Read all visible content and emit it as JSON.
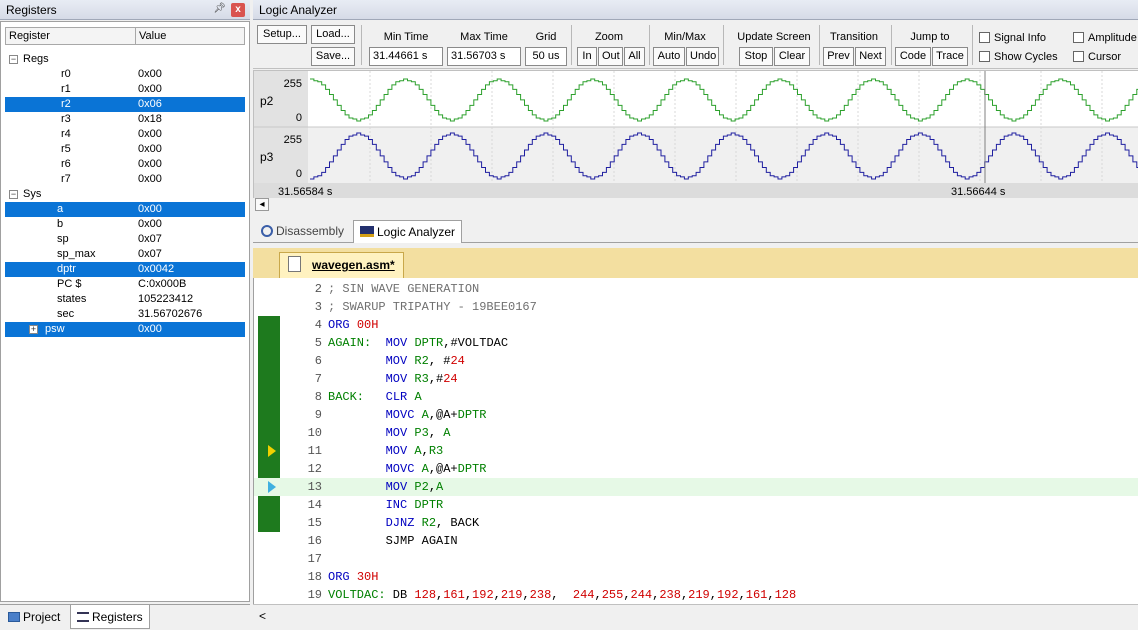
{
  "registers_panel": {
    "title": "Registers",
    "pin": "\u0013",
    "col_register": "Register",
    "col_value": "Value",
    "groups": [
      {
        "name": "Regs",
        "expander": "−"
      },
      {
        "name": "Sys",
        "expander": "−"
      }
    ],
    "regs": [
      {
        "name": "r0",
        "value": "0x00"
      },
      {
        "name": "r1",
        "value": "0x00"
      },
      {
        "name": "r2",
        "value": "0x06"
      },
      {
        "name": "r3",
        "value": "0x18"
      },
      {
        "name": "r4",
        "value": "0x00"
      },
      {
        "name": "r5",
        "value": "0x00"
      },
      {
        "name": "r6",
        "value": "0x00"
      },
      {
        "name": "r7",
        "value": "0x00"
      }
    ],
    "sys": [
      {
        "name": "a",
        "value": "0x00"
      },
      {
        "name": "b",
        "value": "0x00"
      },
      {
        "name": "sp",
        "value": "0x07"
      },
      {
        "name": "sp_max",
        "value": "0x07"
      },
      {
        "name": "dptr",
        "value": "0x0042"
      },
      {
        "name": "PC  $",
        "value": "C:0x000B"
      },
      {
        "name": "states",
        "value": "105223412"
      },
      {
        "name": "sec",
        "value": "31.56702676"
      },
      {
        "name": "psw",
        "value": "0x00"
      }
    ],
    "psw_expander": "+",
    "tabs": {
      "project": "Project",
      "registers": "Registers"
    }
  },
  "logic_analyzer": {
    "title": "Logic Analyzer",
    "setup": "Setup...",
    "load": "Load...",
    "save": "Save...",
    "min_time_label": "Min Time",
    "min_time": "31.44661 s",
    "max_time_label": "Max Time",
    "max_time": "31.56703 s",
    "grid_label": "Grid",
    "grid": "50 us",
    "zoom_label": "Zoom",
    "zoom_in": "In",
    "zoom_out": "Out",
    "zoom_all": "All",
    "minmax_label": "Min/Max",
    "auto": "Auto",
    "undo": "Undo",
    "update_label": "Update Screen",
    "stop": "Stop",
    "clear": "Clear",
    "transition_label": "Transition",
    "prev": "Prev",
    "next": "Next",
    "jump_label": "Jump to",
    "code": "Code",
    "trace": "Trace",
    "signal_info": "Signal Info",
    "amplitude": "Amplitude",
    "show_cycles": "Show Cycles",
    "cursor": "Cursor",
    "signals": [
      {
        "name": "p2",
        "max": "255",
        "min": "0",
        "color": "#2ca02c"
      },
      {
        "name": "p3",
        "max": "255",
        "min": "0",
        "color": "#1f1fa0"
      }
    ],
    "time_left": "31.56584 s",
    "time_right": "31.56644 s",
    "scroll_left": "◂"
  },
  "editor_tabs": {
    "disassembly": "Disassembly",
    "logic_analyzer": "Logic Analyzer"
  },
  "file_tab": "wavegen.asm*",
  "code": [
    {
      "n": "2",
      "parts": [
        [
          "cm",
          "; SIN WAVE GENERATION"
        ]
      ]
    },
    {
      "n": "3",
      "parts": [
        [
          "cm",
          "; SWARUP TRIPATHY - 19BEE0167"
        ]
      ]
    },
    {
      "n": "4",
      "parts": [
        [
          "kw",
          "ORG "
        ],
        [
          "nm",
          "00H"
        ]
      ]
    },
    {
      "n": "5",
      "parts": [
        [
          "lb",
          "AGAIN:"
        ],
        [
          "",
          "  "
        ],
        [
          "kw",
          "MOV "
        ],
        [
          "lb",
          "DPTR"
        ],
        [
          "",
          ",#VOLTDAC"
        ]
      ]
    },
    {
      "n": "6",
      "parts": [
        [
          "",
          "        "
        ],
        [
          "kw",
          "MOV "
        ],
        [
          "lb",
          "R2"
        ],
        [
          "",
          ", #"
        ],
        [
          "nm",
          "24"
        ]
      ]
    },
    {
      "n": "7",
      "parts": [
        [
          "",
          "        "
        ],
        [
          "kw",
          "MOV "
        ],
        [
          "lb",
          "R3"
        ],
        [
          "",
          ",#"
        ],
        [
          "nm",
          "24"
        ]
      ]
    },
    {
      "n": "8",
      "parts": [
        [
          "lb",
          "BACK:"
        ],
        [
          "",
          "   "
        ],
        [
          "kw",
          "CLR "
        ],
        [
          "lb",
          "A"
        ]
      ]
    },
    {
      "n": "9",
      "parts": [
        [
          "",
          "        "
        ],
        [
          "kw",
          "MOVC "
        ],
        [
          "lb",
          "A"
        ],
        [
          "",
          ",@A+"
        ],
        [
          "lb",
          "DPTR"
        ]
      ]
    },
    {
      "n": "10",
      "parts": [
        [
          "",
          "        "
        ],
        [
          "kw",
          "MOV "
        ],
        [
          "lb",
          "P3"
        ],
        [
          "",
          ", "
        ],
        [
          "lb",
          "A"
        ]
      ]
    },
    {
      "n": "11",
      "parts": [
        [
          "",
          "        "
        ],
        [
          "kw",
          "MOV "
        ],
        [
          "lb",
          "A"
        ],
        [
          "",
          ","
        ],
        [
          "lb",
          "R3"
        ]
      ]
    },
    {
      "n": "12",
      "parts": [
        [
          "",
          "        "
        ],
        [
          "kw",
          "MOVC "
        ],
        [
          "lb",
          "A"
        ],
        [
          "",
          ",@A+"
        ],
        [
          "lb",
          "DPTR"
        ]
      ]
    },
    {
      "n": "13",
      "parts": [
        [
          "",
          "        "
        ],
        [
          "kw",
          "MOV "
        ],
        [
          "lb",
          "P2"
        ],
        [
          "",
          ","
        ],
        [
          "lb",
          "A"
        ]
      ]
    },
    {
      "n": "14",
      "parts": [
        [
          "",
          "        "
        ],
        [
          "kw",
          "INC "
        ],
        [
          "lb",
          "DPTR"
        ]
      ]
    },
    {
      "n": "15",
      "parts": [
        [
          "",
          "        "
        ],
        [
          "kw",
          "DJNZ "
        ],
        [
          "lb",
          "R2"
        ],
        [
          "",
          ", BACK"
        ]
      ]
    },
    {
      "n": "16",
      "parts": [
        [
          "",
          "        SJMP AGAIN"
        ]
      ]
    },
    {
      "n": "17",
      "parts": [
        [
          "",
          ""
        ]
      ]
    },
    {
      "n": "18",
      "parts": [
        [
          "kw",
          "ORG "
        ],
        [
          "nm",
          "30H"
        ]
      ]
    },
    {
      "n": "19",
      "parts": [
        [
          "lb",
          "VOLTDAC:"
        ],
        [
          "",
          " DB "
        ],
        [
          "nm",
          "128"
        ],
        [
          "",
          ","
        ],
        [
          "nm",
          "161"
        ],
        [
          "",
          ","
        ],
        [
          "nm",
          "192"
        ],
        [
          "",
          ","
        ],
        [
          "nm",
          "219"
        ],
        [
          "",
          ","
        ],
        [
          "nm",
          "238"
        ],
        [
          "",
          ",  "
        ],
        [
          "nm",
          "244"
        ],
        [
          "",
          ","
        ],
        [
          "nm",
          "255"
        ],
        [
          "",
          ","
        ],
        [
          "nm",
          "244"
        ],
        [
          "",
          ","
        ],
        [
          "nm",
          "238"
        ],
        [
          "",
          ","
        ],
        [
          "nm",
          "219"
        ],
        [
          "",
          ","
        ],
        [
          "nm",
          "192"
        ],
        [
          "",
          ","
        ],
        [
          "nm",
          "161"
        ],
        [
          "",
          ","
        ],
        [
          "nm",
          "128"
        ]
      ]
    }
  ],
  "editor_scroll_left": "<"
}
